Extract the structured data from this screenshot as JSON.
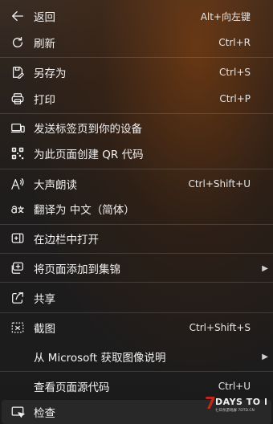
{
  "menu": {
    "back": {
      "label": "返回",
      "shortcut": "Alt+向左键"
    },
    "refresh": {
      "label": "刷新",
      "shortcut": "Ctrl+R"
    },
    "save_as": {
      "label": "另存为",
      "shortcut": "Ctrl+S"
    },
    "print": {
      "label": "打印",
      "shortcut": "Ctrl+P"
    },
    "send_to_devices": {
      "label": "发送标签页到你的设备"
    },
    "qr_code": {
      "label": "为此页面创建 QR 代码"
    },
    "read_aloud": {
      "label": "大声朗读",
      "shortcut": "Ctrl+Shift+U"
    },
    "translate": {
      "label": "翻译为 中文（简体）"
    },
    "open_sidebar": {
      "label": "在边栏中打开"
    },
    "add_to_collections": {
      "label": "将页面添加到集锦"
    },
    "share": {
      "label": "共享"
    },
    "screenshot": {
      "label": "截图",
      "shortcut": "Ctrl+Shift+S"
    },
    "image_descriptions": {
      "label": "从 Microsoft 获取图像说明"
    },
    "view_source": {
      "label": "查看页面源代码",
      "shortcut": "Ctrl+U"
    },
    "inspect": {
      "label": "检查"
    }
  },
  "watermark": {
    "text": "DAYS TO DIE",
    "digit": "7",
    "subtext": "七日杀游戏群 7DTD.CN"
  },
  "colors": {
    "accent": "#c0281c",
    "text": "#f3f3f3"
  }
}
